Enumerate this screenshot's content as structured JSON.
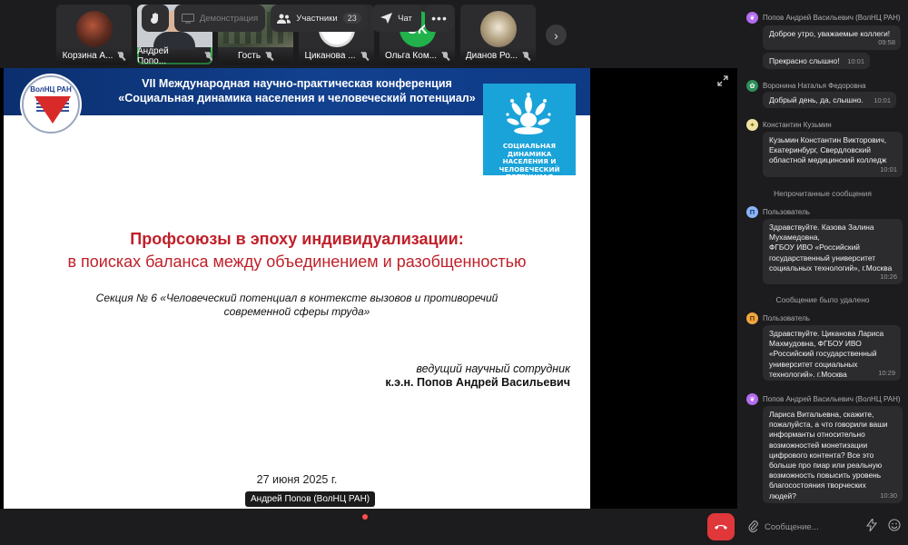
{
  "participants": [
    {
      "name": "Корзина А...",
      "active": false
    },
    {
      "name": "Андрей Попо...",
      "active": true
    },
    {
      "name": "Гость",
      "active": false
    },
    {
      "name": "Циканова ...",
      "active": false
    },
    {
      "name": "Ольга Ком...",
      "avatar_text": "OK",
      "active": false
    },
    {
      "name": "Дианов Ро...",
      "active": false
    }
  ],
  "slide": {
    "org_logo_text": "ВолНЦ РАН",
    "header_line1": "VII Международная научно-практическая конференция",
    "header_line2": "«Социальная динамика населения и человеческий потенциал»",
    "conf_logo_text": "СОЦИАЛЬНАЯ ДИНАМИКА НАСЕЛЕНИЯ И ЧЕЛОВЕЧЕСКИЙ ПОТЕНЦИАЛ",
    "title_line1": "Профсоюзы в эпоху индивидуализации:",
    "title_line2": "в поисках баланса между объединением и разобщенностью",
    "section_line1": "Секция № 6 «Человеческий потенциал в контексте вызовов и противоречий",
    "section_line2": "современной сферы труда»",
    "role": "ведущий научный сотрудник",
    "author": "к.э.н. Попов Андрей Васильевич",
    "date": "27 июня 2025 г."
  },
  "presenter_tag": "Андрей Попов (ВолНЦ РАН)",
  "toolbar": {
    "demo_label": "Демонстрация",
    "participants_label": "Участники",
    "participants_count": "23",
    "chat_label": "Чат"
  },
  "chat": {
    "messages": [
      {
        "author": "Попов Андрей Васильевич (ВолНЦ РАН)",
        "lines": [
          "Доброе утро, уважаемые коллеги!"
        ],
        "time": "09:58"
      },
      {
        "lines": [
          "Прекрасно слышно!"
        ],
        "time": "10:01"
      },
      {
        "author": "Воронина Наталья Федоровна",
        "lines": [
          "Добрый день, да, слышно."
        ],
        "time": "10:01"
      },
      {
        "author": "Константин Кузьмин",
        "lines": [
          "Кузьмин Константин Викторович,",
          "Екатеринбург, Свердловский",
          "областной медицинский колледж"
        ],
        "time": "10:01"
      },
      {
        "author": "Пользователь",
        "lines": [
          "Здравствуйте. Казова Залина",
          "Мухамедовна,",
          "ФГБОУ ИВО «Российский",
          "государственный университет",
          "социальных технологий», г.Москва"
        ],
        "time": "10:26"
      },
      {
        "author": "Пользователь",
        "lines": [
          "Здравствуйте. Циканова Лариса",
          "Махмудовна, ФГБОУ ИВО",
          "«Российский государственный",
          "университет социальных",
          "технологий». г.Москва"
        ],
        "time": "10:29"
      },
      {
        "author": "Попов Андрей Васильевич (ВолНЦ РАН)",
        "lines": [
          "Лариса Витальевна, скажите,",
          "пожалуйста, а что говорили ваши",
          "информанты относительно",
          "возможностей монетизации",
          "цифрового контента? Все это",
          "больше про пиар или реальную",
          "возможность повысить уровень",
          "благосостояния творческих",
          "людей?"
        ],
        "time": "10:30"
      }
    ],
    "unread_divider": "Непрочитанные сообщения",
    "deleted_notice": "Сообщение было удалено",
    "user_avatar_letter": "П",
    "composer_placeholder": "Сообщение..."
  }
}
